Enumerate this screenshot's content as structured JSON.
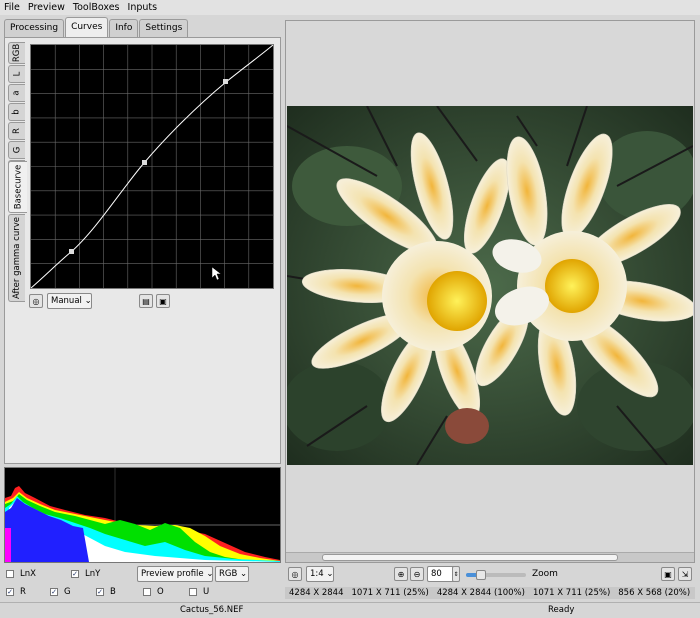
{
  "menu": {
    "items": [
      "File",
      "Preview",
      "ToolBoxes",
      "Inputs"
    ]
  },
  "tabs": [
    {
      "label": "Processing",
      "active": false
    },
    {
      "label": "Curves",
      "active": true
    },
    {
      "label": "Info",
      "active": false
    },
    {
      "label": "Settings",
      "active": false
    }
  ],
  "curve_channels": [
    "RGB",
    "L",
    "a",
    "b",
    "R",
    "G",
    "B",
    "Basecurve",
    "After gamma curve"
  ],
  "curve_controls": {
    "mode": "Manual"
  },
  "histogram_options": {
    "lnx": {
      "label": "LnX",
      "checked": false
    },
    "lny": {
      "label": "LnY",
      "checked": true
    },
    "profile": "Preview profile",
    "space": "RGB",
    "r": {
      "label": "R",
      "checked": true
    },
    "g": {
      "label": "G",
      "checked": true
    },
    "b": {
      "label": "B",
      "checked": true
    },
    "o": {
      "label": "O",
      "checked": false
    },
    "u": {
      "label": "U",
      "checked": false
    }
  },
  "view": {
    "zoom_ratio": "1:4",
    "zoom_value": "80",
    "zoom_label": "Zoom"
  },
  "sizes": [
    "4284 X 2844",
    "1071 X 711 (25%)",
    "4284 X 2844 (100%)",
    "1071 X 711 (25%)",
    "856 X 568 (20%)"
  ],
  "status": {
    "filename": "Cactus_56.NEF",
    "state": "Ready"
  }
}
